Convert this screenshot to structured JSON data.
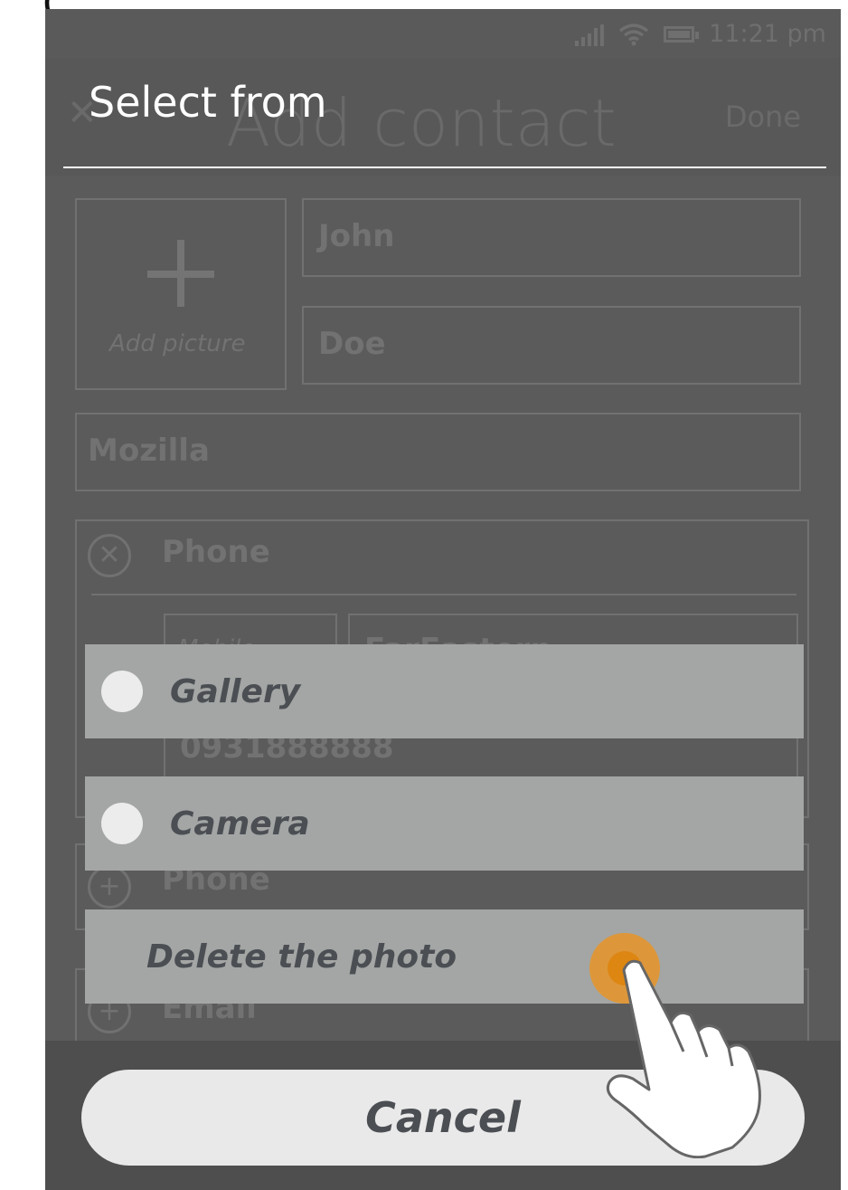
{
  "status_bar": {
    "time": "11:21 pm",
    "signal_icon": "signal-icon",
    "wifi_icon": "wifi-icon",
    "battery_icon": "battery-icon"
  },
  "dialog": {
    "title": "Select from"
  },
  "background": {
    "title": "Add contact",
    "done": "Done",
    "add_picture": "Add picture",
    "first_name": "John",
    "last_name": "Doe",
    "company": "Mozilla",
    "phone_label": "Phone",
    "phone_type": "Mobile",
    "carrier": "FarEastern",
    "phone_number": "0931888888",
    "add_phone_label": "Phone",
    "add_email_label": "Email"
  },
  "options": [
    {
      "label": "Gallery"
    },
    {
      "label": "Camera"
    },
    {
      "label": "Delete the photo"
    }
  ],
  "cancel": {
    "label": "Cancel"
  },
  "colors": {
    "overlay": "#5b5b5b",
    "option_bg": "#a3a6a4",
    "option_text": "#4b4e53",
    "radio": "#ececec",
    "cancel_bg": "#e9e9e9",
    "touch_accent": "#de8612"
  }
}
